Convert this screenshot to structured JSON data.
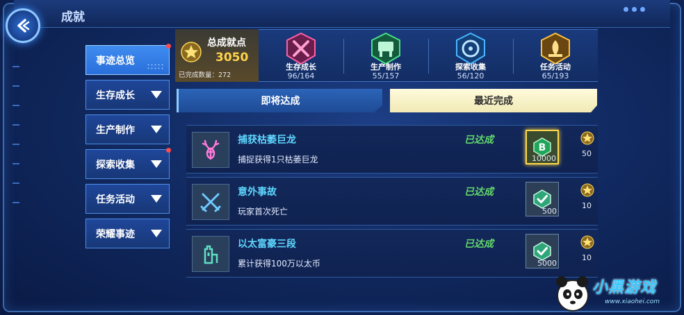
{
  "header": {
    "title": "成就"
  },
  "sidebar": {
    "items": [
      {
        "label": "事迹总览",
        "active": true,
        "dot": true
      },
      {
        "label": "生存成长",
        "active": false,
        "dot": false
      },
      {
        "label": "生产制作",
        "active": false,
        "dot": false
      },
      {
        "label": "探索收集",
        "active": false,
        "dot": true
      },
      {
        "label": "任务活动",
        "active": false,
        "dot": false
      },
      {
        "label": "荣耀事迹",
        "active": false,
        "dot": false
      }
    ]
  },
  "summary": {
    "total_label": "总成就点",
    "total_value": "3050",
    "done_label": "已完成数量：",
    "done_value": "272",
    "categories": [
      {
        "name": "生存成长",
        "progress": "96/164",
        "color": "#ff5fa8",
        "icon": "crossed-swords-icon"
      },
      {
        "name": "生产制作",
        "progress": "55/157",
        "color": "#48e08a",
        "icon": "workbench-icon"
      },
      {
        "name": "探索收集",
        "progress": "56/120",
        "color": "#48b6ff",
        "icon": "compass-icon"
      },
      {
        "name": "任务活动",
        "progress": "65/193",
        "color": "#ffc23d",
        "icon": "scroll-icon"
      }
    ]
  },
  "tabs": {
    "upcoming": "即将达成",
    "recent": "最近完成"
  },
  "achievements": [
    {
      "title": "捕获枯萎巨龙",
      "desc": "捕捉获得1只枯萎巨龙",
      "status": "已达成",
      "reward_icon": "b-coin-icon",
      "reward": "10000",
      "points": "50",
      "icon": "deer-antler-icon",
      "icon_color": "#ff7ad9"
    },
    {
      "title": "意外事故",
      "desc": "玩家首次死亡",
      "status": "已达成",
      "reward_icon": "check-gem-icon",
      "reward": "500",
      "points": "10",
      "icon": "crossed-swords-icon",
      "icon_color": "#6fc9ff"
    },
    {
      "title": "以太富豪三段",
      "desc": "累计获得100万以太币",
      "status": "已达成",
      "reward_icon": "check-gem-icon",
      "reward": "5000",
      "points": "10",
      "icon": "castle-tower-icon",
      "icon_color": "#5fe0c3"
    }
  ],
  "watermark": {
    "text": "小黑游戏",
    "url": "www.xiaohei.com"
  }
}
